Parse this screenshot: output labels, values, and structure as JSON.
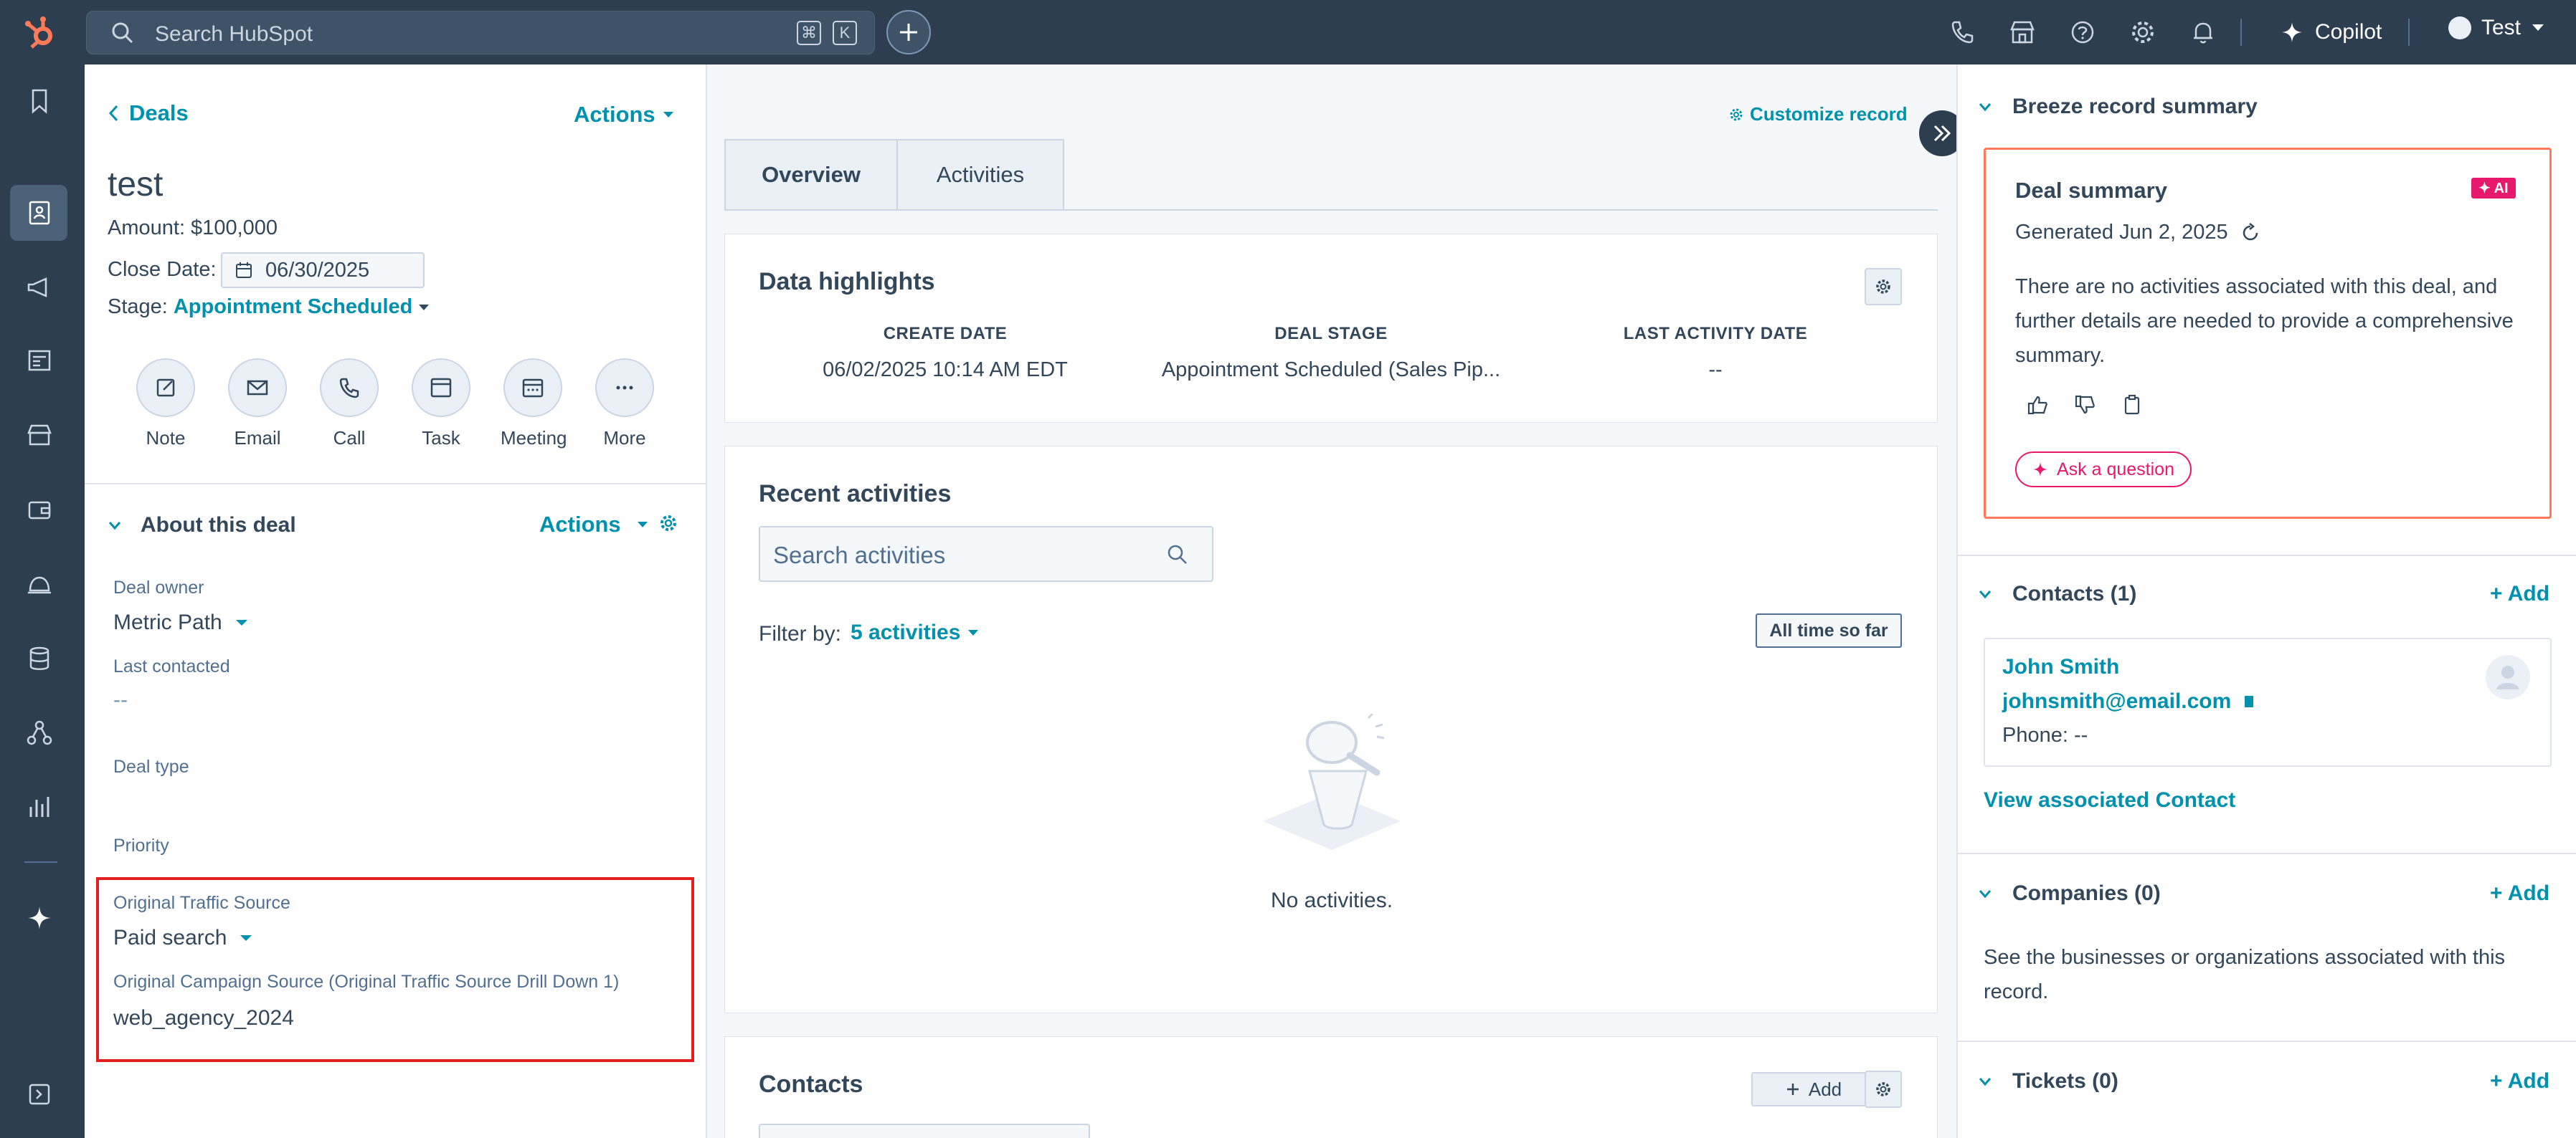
{
  "topnav": {
    "search_placeholder": "Search HubSpot",
    "kbd_cmd": "⌘",
    "kbd_k": "K",
    "copilot_label": "Copilot",
    "account_label": "Test"
  },
  "left": {
    "back_label": "Deals",
    "actions_label": "Actions",
    "deal_name": "test",
    "amount": "Amount: $100,000",
    "close_date_label": "Close Date:",
    "close_date_value": "06/30/2025",
    "stage_label": "Stage:",
    "stage_value": "Appointment Scheduled",
    "activity_buttons": [
      "Note",
      "Email",
      "Call",
      "Task",
      "Meeting",
      "More"
    ],
    "about_title": "About this deal",
    "about_actions": "Actions",
    "deal_owner_label": "Deal owner",
    "deal_owner_value": "Metric Path",
    "last_contacted_label": "Last contacted",
    "last_contacted_value": "--",
    "deal_type_label": "Deal type",
    "priority_label": "Priority",
    "traffic_source_label": "Original Traffic Source",
    "traffic_source_value": "Paid search",
    "campaign_source_label": "Original Campaign Source (Original Traffic Source Drill Down 1)",
    "campaign_source_value": "web_agency_2024",
    "highlight_color": "#e41e1e"
  },
  "middle": {
    "customize_label": "Customize record",
    "tabs": [
      "Overview",
      "Activities"
    ],
    "highlights_title": "Data highlights",
    "highlight_cols": [
      {
        "header": "CREATE DATE",
        "value": "06/02/2025 10:14 AM EDT"
      },
      {
        "header": "DEAL STAGE",
        "value": "Appointment Scheduled (Sales Pip..."
      },
      {
        "header": "LAST ACTIVITY DATE",
        "value": "--"
      }
    ],
    "recent_title": "Recent activities",
    "search_activities_placeholder": "Search activities",
    "filter_label": "Filter by:",
    "filter_value": "5 activities",
    "time_button": "All time so far",
    "empty_text": "No activities.",
    "contacts_title": "Contacts",
    "contacts_add": "Add"
  },
  "right": {
    "breeze_title": "Breeze record summary",
    "summary_title": "Deal summary",
    "ai_badge": "✦ AI",
    "generated": "Generated Jun 2, 2025",
    "summary_text": "There are no activities associated with this deal, and further details are needed to provide a comprehensive summary.",
    "ask_label": "Ask a question",
    "contacts_title": "Contacts (1)",
    "add_label": "+ Add",
    "contact_name": "John Smith",
    "contact_email": "johnsmith@email.com",
    "contact_phone": "Phone: --",
    "view_contact": "View associated Contact",
    "companies_title": "Companies (0)",
    "companies_text": "See the businesses or organizations associated with this record.",
    "tickets_title": "Tickets (0)"
  },
  "colors": {
    "nav": "#2d3e50",
    "accent": "#0091ae",
    "ai_accent": "#e8186c",
    "hubspot_orange": "#ff7a59"
  }
}
